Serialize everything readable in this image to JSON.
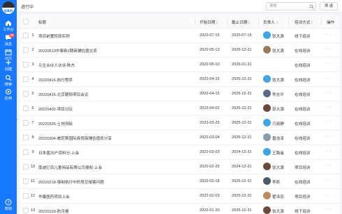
{
  "sidebar": {
    "logo_text": "钛其科",
    "items": [
      {
        "label": "工作台",
        "icon": "home-icon"
      },
      {
        "label": "消息",
        "icon": "message-icon",
        "badge": "99"
      },
      {
        "label": "日历",
        "icon": "calendar-icon"
      },
      {
        "label": "创建",
        "icon": "plus-icon"
      },
      {
        "label": "搜索",
        "icon": "search-icon"
      },
      {
        "label": "应用",
        "icon": "apps-icon"
      }
    ],
    "help_label": "帮助",
    "help_icon": "help-icon"
  },
  "header": {
    "title": "进行中",
    "search_placeholder": "搜索",
    "filter_label": "筛 选"
  },
  "table": {
    "columns": [
      "序号",
      "标题",
      "开始日期",
      "截止日期",
      "负责人",
      "培训方式",
      "操作"
    ],
    "rows": [
      {
        "no": "1",
        "title": "项目前置阶段实例",
        "start": "2022-07-15",
        "end": "2025-07-15",
        "owner": "张大源",
        "mode": "线下培训",
        "avatar_color": "#3ea6e8"
      },
      {
        "no": "2",
        "title": "20220513中泰新2期商铺估值交流",
        "start": "2022-05-13",
        "end": "2025-12-31",
        "owner": "张大源",
        "mode": "在线培训",
        "avatar_color": "#9b7a5a"
      },
      {
        "no": "3",
        "title": "元生合伙人访谈-陈杰",
        "start": "2022-05-10",
        "end": "2026-01-31",
        "owner": "",
        "mode": "在线培训",
        "avatar_color": ""
      },
      {
        "no": "4",
        "title": "20220415-执行程序",
        "start": "2022-04-15",
        "end": "2025-12-31",
        "owner": "张大源",
        "mode": "在线培训",
        "avatar_color": "#3ea6e8"
      },
      {
        "no": "5",
        "title": "20220415-北京朝阳项目会议",
        "start": "2022-04-15",
        "end": "2025-12-31",
        "owner": "李志平",
        "mode": "在线培训",
        "avatar_color": "#5a6b8a"
      },
      {
        "no": "6",
        "title": "20220402-项目讨论",
        "start": "2022-04-02",
        "end": "2025-12-31",
        "owner": "张大源",
        "mode": "在线培训",
        "avatar_color": "#6b4a3a"
      },
      {
        "no": "7",
        "title": "20220325-土地测绘",
        "start": "2022-03-25",
        "end": "2025-12-31",
        "owner": "万丽静",
        "mode": "在线培训",
        "avatar_color": "#3ea6e8"
      },
      {
        "no": "8",
        "title": "20220304-威尼斯国际商贸商铺估值员分享",
        "start": "2022-03-04",
        "end": "2025-12-31",
        "owner": "雷浩泽",
        "mode": "在线培训",
        "avatar_color": "#8a9aa8"
      },
      {
        "no": "9",
        "title": "日本盛20户资料分-上会",
        "start": "2022-03-03",
        "end": "2024-12-31",
        "owner": "王路遥",
        "mode": "在线培训",
        "avatar_color": "#3ea6e8"
      },
      {
        "no": "10",
        "title": "南迪亿百儿童用品有限公司德权-上会",
        "start": "2022-02-25",
        "end": "2024-12-31",
        "owner": "张大源",
        "mode": "项目培训",
        "avatar_color": "#6b4a3a"
      },
      {
        "no": "11",
        "title": "20220218-强制执行中的常见侵害问题",
        "start": "2022-02-18",
        "end": "2025-12-31",
        "owner": "李凯",
        "mode": "在线培训",
        "avatar_color": "#4a5a6a"
      },
      {
        "no": "12",
        "title": "华康医药项目上会",
        "start": "2022-02-03",
        "end": "2025-12-31",
        "owner": "翟泽农",
        "mode": "项目培训",
        "avatar_color": "#c28a5a"
      },
      {
        "no": "13",
        "title": "20220120-防月报",
        "start": "2022-01-20",
        "end": "2025-12-31",
        "owner": "张大源",
        "mode": "线下培训",
        "avatar_color": "#6b4a3a"
      }
    ],
    "more_label": "···"
  },
  "colors": {
    "primary": "#1677ff",
    "badge": "#ff4d4f"
  }
}
